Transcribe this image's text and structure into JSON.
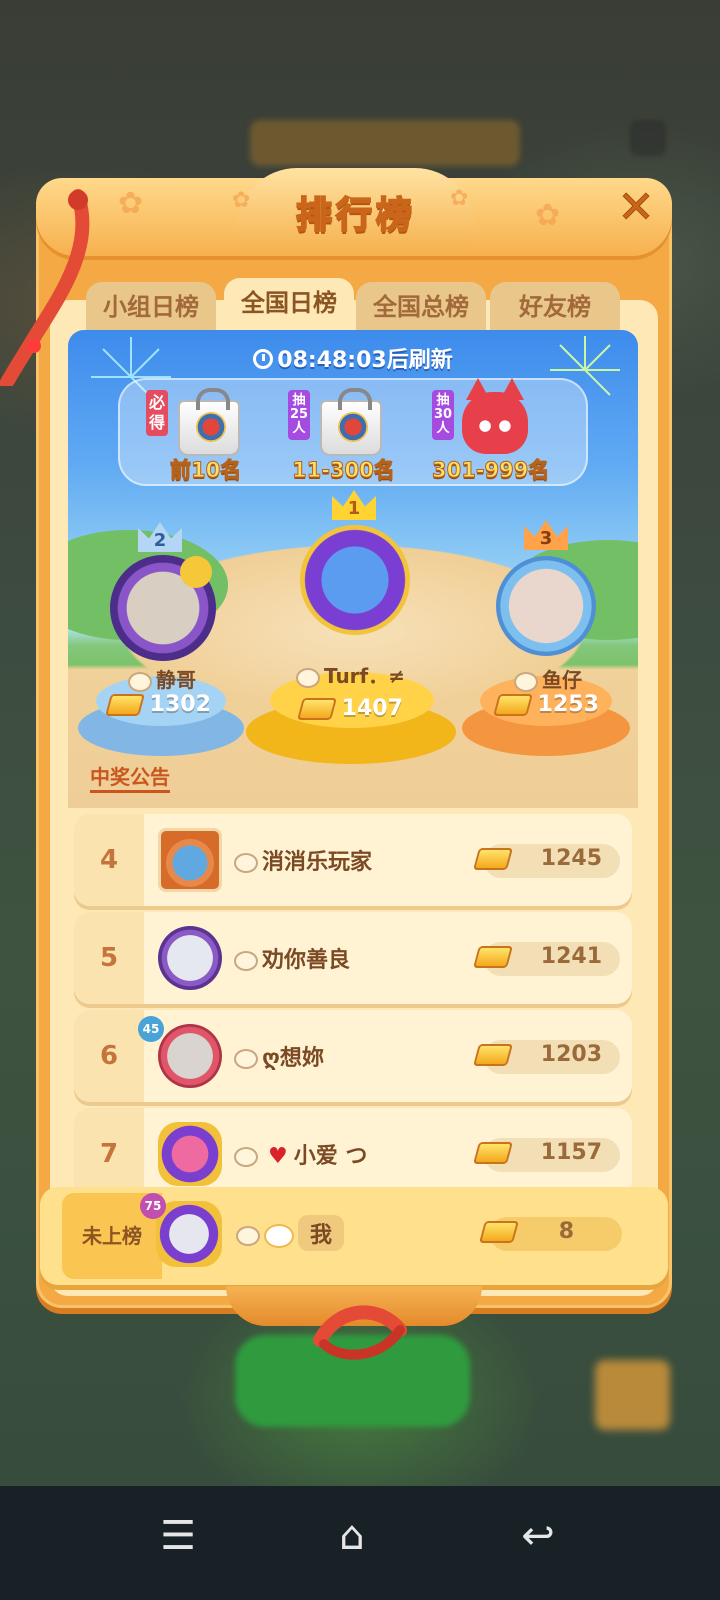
{
  "header": {
    "title": "排行榜"
  },
  "tabs": [
    {
      "label": "小组日榜",
      "active": false
    },
    {
      "label": "全国日榜",
      "active": true
    },
    {
      "label": "全国总榜",
      "active": false
    },
    {
      "label": "好友榜",
      "active": false
    }
  ],
  "refresh": {
    "time": "08:48:03",
    "suffix": "后刷新"
  },
  "rewards": [
    {
      "tag": "必得",
      "label": "前10名",
      "icon": "gift-bag-icon"
    },
    {
      "tag": "抽25人",
      "label": "11-300名",
      "icon": "gift-bag-icon"
    },
    {
      "tag": "抽30人",
      "label": "301-999名",
      "icon": "fox-plush-icon"
    }
  ],
  "podium": [
    {
      "rank": "1",
      "name": "Turf．≠",
      "score": "1407"
    },
    {
      "rank": "2",
      "name": "静哥",
      "score": "1302"
    },
    {
      "rank": "3",
      "name": "鱼仔",
      "score": "1253"
    }
  ],
  "notice": "中奖公告",
  "list": [
    {
      "rank": "4",
      "name": "消消乐玩家",
      "score": "1245"
    },
    {
      "rank": "5",
      "name": "劝你善良",
      "score": "1241"
    },
    {
      "rank": "6",
      "name": "ღ想妳",
      "score": "1203",
      "level": "45"
    },
    {
      "rank": "7",
      "name": "小爱 つ",
      "score": "1157"
    }
  ],
  "self": {
    "rank": "未上榜",
    "name": "我",
    "score": "8",
    "level": "75"
  },
  "colors": {
    "panel": "#f5a945",
    "inner": "#fde8b6",
    "accent": "#c9561f"
  }
}
